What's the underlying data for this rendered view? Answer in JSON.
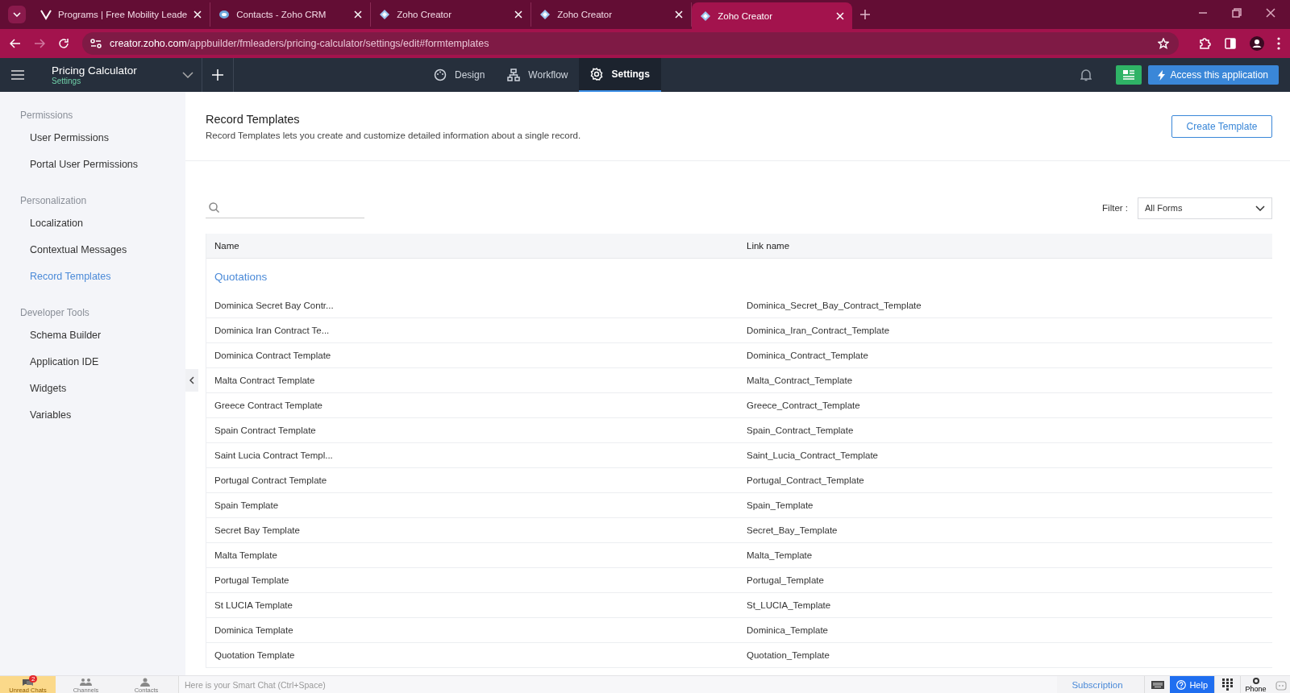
{
  "browser": {
    "tabs": [
      {
        "title": "Programs | Free Mobility Leade",
        "kind": "v",
        "selected": false
      },
      {
        "title": "Contacts - Zoho CRM",
        "kind": "crm",
        "selected": false
      },
      {
        "title": "Zoho Creator",
        "kind": "creator",
        "selected": false
      },
      {
        "title": "Zoho Creator",
        "kind": "creator",
        "selected": false
      },
      {
        "title": "Zoho Creator",
        "kind": "creator",
        "selected": true
      }
    ],
    "url_host": "creator.zoho.com",
    "url_path": "/appbuilder/fmleaders/pricing-calculator/settings/edit#formtemplates"
  },
  "app": {
    "title": "Pricing Calculator",
    "subtitle": "Settings",
    "nav": [
      {
        "label": "Design",
        "selected": false
      },
      {
        "label": "Workflow",
        "selected": false
      },
      {
        "label": "Settings",
        "selected": true
      }
    ],
    "access_button": "Access this application"
  },
  "sidebar": {
    "groups": [
      {
        "title": "Permissions",
        "items": [
          {
            "label": "User Permissions",
            "selected": false
          },
          {
            "label": "Portal User Permissions",
            "selected": false
          }
        ]
      },
      {
        "title": "Personalization",
        "items": [
          {
            "label": "Localization",
            "selected": false
          },
          {
            "label": "Contextual Messages",
            "selected": false
          },
          {
            "label": "Record Templates",
            "selected": true
          }
        ]
      },
      {
        "title": "Developer Tools",
        "items": [
          {
            "label": "Schema Builder",
            "selected": false
          },
          {
            "label": "Application IDE",
            "selected": false
          },
          {
            "label": "Widgets",
            "selected": false
          },
          {
            "label": "Variables",
            "selected": false
          }
        ]
      }
    ]
  },
  "page": {
    "title": "Record Templates",
    "description": "Record Templates lets you create and customize detailed information about a single record.",
    "create_button": "Create Template",
    "filter_label": "Filter :",
    "filter_value": "All Forms"
  },
  "table": {
    "columns": [
      "Name",
      "Link name"
    ],
    "groups": [
      {
        "title": "Quotations",
        "rows": [
          [
            "Dominica Secret Bay Contr...",
            "Dominica_Secret_Bay_Contract_Template"
          ],
          [
            "Dominica Iran Contract Te...",
            "Dominica_Iran_Contract_Template"
          ],
          [
            "Dominica Contract Template",
            "Dominica_Contract_Template"
          ],
          [
            "Malta Contract Template",
            "Malta_Contract_Template"
          ],
          [
            "Greece Contract Template",
            "Greece_Contract_Template"
          ],
          [
            "Spain Contract Template",
            "Spain_Contract_Template"
          ],
          [
            "Saint Lucia Contract Templ...",
            "Saint_Lucia_Contract_Template"
          ],
          [
            "Portugal Contract Template",
            "Portugal_Contract_Template"
          ],
          [
            "Spain Template",
            "Spain_Template"
          ],
          [
            "Secret Bay Template",
            "Secret_Bay_Template"
          ],
          [
            "Malta Template",
            "Malta_Template"
          ],
          [
            "Portugal Template",
            "Portugal_Template"
          ],
          [
            "St LUCIA Template",
            "St_LUCIA_Template"
          ],
          [
            "Dominica Template",
            "Dominica_Template"
          ],
          [
            "Quotation Template",
            "Quotation_Template"
          ]
        ]
      }
    ]
  },
  "chat_bar": {
    "items": [
      {
        "label": "Unread Chats",
        "badge": "2",
        "selected": true
      },
      {
        "label": "Channels",
        "selected": false
      },
      {
        "label": "Contacts",
        "selected": false
      }
    ],
    "placeholder": "Here is your Smart Chat (Ctrl+Space)",
    "subscription": "Subscription",
    "help": "Help",
    "phone": "Phone"
  }
}
